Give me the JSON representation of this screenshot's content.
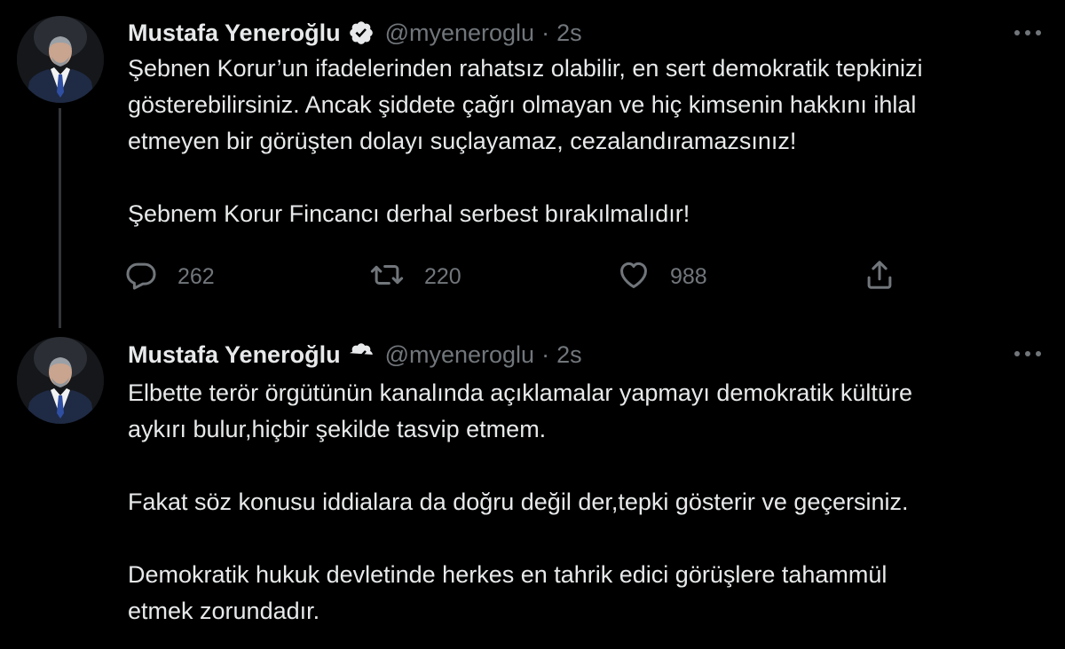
{
  "colors": {
    "background": "#000000",
    "text": "#e7e9ea",
    "muted": "#71767b",
    "thread_line": "#333639"
  },
  "tweets": [
    {
      "author": {
        "name": "Mustafa Yeneroğlu",
        "handle": "@myeneroglu",
        "verified": true,
        "verified_icon": "verified-badge-icon"
      },
      "separator": "·",
      "time": "2s",
      "paragraphs": [
        "Şebnen Korur’un ifadelerinden rahatsız olabilir, en sert demokratik tepkinizi",
        "gösterebilirsiniz. Ancak şiddete çağrı olmayan ve hiç kimsenin hakkını ihlal",
        "etmeyen bir görüşten dolayı suçlayamaz, cezalandıramazsınız!",
        "",
        "Şebnem Korur Fincancı derhal serbest bırakılmalıdır!"
      ],
      "actions": {
        "reply": {
          "icon": "reply-icon",
          "count": "262"
        },
        "retweet": {
          "icon": "retweet-icon",
          "count": "220"
        },
        "like": {
          "icon": "heart-icon",
          "count": "988"
        },
        "share": {
          "icon": "share-icon"
        }
      }
    },
    {
      "author": {
        "name": "Mustafa Yeneroğlu",
        "handle": "@myeneroglu",
        "verified": true,
        "verified_icon": "verified-badge-icon"
      },
      "separator": "·",
      "time": "2s",
      "paragraphs": [
        "Elbette terör örgütünün kanalında açıklamalar yapmayı demokratik kültüre",
        "aykırı bulur,hiçbir şekilde tasvip etmem.",
        "",
        "Fakat söz konusu iddialara da doğru değil der,tepki gösterir ve geçersiniz.",
        "",
        "Demokratik hukuk devletinde herkes en tahrik edici görüşlere tahammül",
        "etmek zorundadır."
      ]
    }
  ]
}
